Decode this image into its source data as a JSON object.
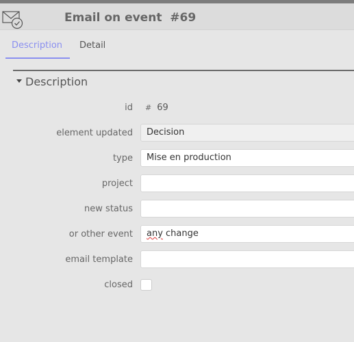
{
  "header": {
    "title": "Email on event  #69",
    "icon": "email-checked-icon"
  },
  "tabs": [
    {
      "label": "Description",
      "active": true
    },
    {
      "label": "Detail",
      "active": false
    }
  ],
  "section": {
    "title": "Description",
    "expanded": true
  },
  "form": {
    "id": {
      "label": "id",
      "symbol": "#",
      "value": "69"
    },
    "element_updated": {
      "label": "element updated",
      "value": "Decision"
    },
    "type": {
      "label": "type",
      "value": "Mise en production"
    },
    "project": {
      "label": "project",
      "value": ""
    },
    "new_status": {
      "label": "new status",
      "value": ""
    },
    "other_event": {
      "label": "or other event",
      "value_misspelled": "any",
      "value_rest": " change"
    },
    "email_template": {
      "label": "email template",
      "value": ""
    },
    "closed": {
      "label": "closed",
      "checked": false
    }
  },
  "colors": {
    "accent": "#8a8ff0",
    "background": "#e6e6e6",
    "topbar": "#7d7d7d"
  }
}
